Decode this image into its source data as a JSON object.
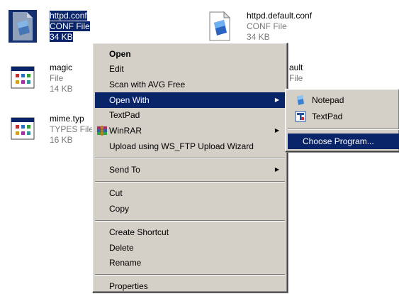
{
  "files": [
    {
      "name": "httpd.conf",
      "type": "CONF File",
      "size": "34 KB",
      "selected": true,
      "icon": "conf-file-icon"
    },
    {
      "name": "httpd.default.conf",
      "type": "CONF File",
      "size": "34 KB",
      "selected": false,
      "icon": "conf-file-icon"
    },
    {
      "name": "magic",
      "type": "File",
      "size": "14 KB",
      "selected": false,
      "icon": "generic-file-icon"
    },
    {
      "name": "ault",
      "type": "File",
      "size": "",
      "selected": false,
      "icon": "generic-file-icon"
    },
    {
      "name": "mime.typ",
      "type": "TYPES File",
      "size": "16 KB",
      "selected": false,
      "icon": "generic-file-icon"
    }
  ],
  "context_menu": {
    "open": "Open",
    "edit": "Edit",
    "scan": "Scan with AVG Free",
    "open_with": "Open With",
    "textpad": "TextPad",
    "winrar": "WinRAR",
    "upload": "Upload using WS_FTP Upload Wizard",
    "send_to": "Send To",
    "cut": "Cut",
    "copy": "Copy",
    "create_shortcut": "Create Shortcut",
    "delete": "Delete",
    "rename": "Rename",
    "properties": "Properties"
  },
  "submenu": {
    "notepad": "Notepad",
    "textpad": "TextPad",
    "choose_program": "Choose Program..."
  },
  "arrow": "▶",
  "colors": {
    "highlight": "#0a246a",
    "menu_bg": "#d4d0c8",
    "grey_text": "#7a7a7a"
  }
}
